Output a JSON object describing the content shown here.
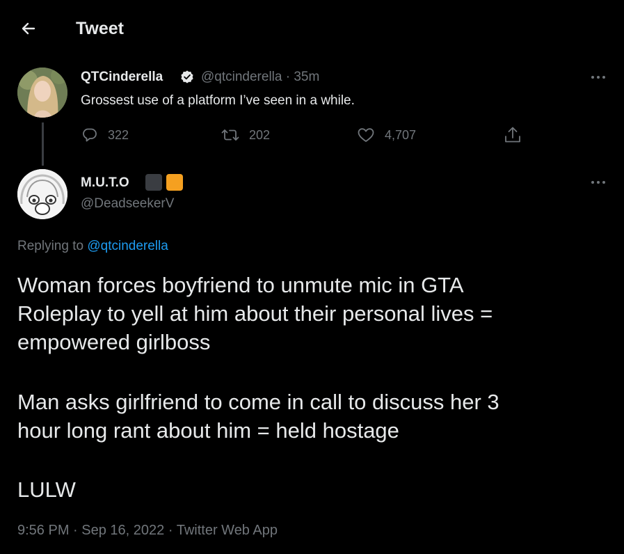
{
  "header": {
    "title": "Tweet"
  },
  "parent_tweet": {
    "name": "QTCinderella",
    "handle": "@qtcinderella",
    "separator": "·",
    "time": "35m",
    "text": "Grossest use of a platform I’ve seen in a while.",
    "replies": "322",
    "retweets": "202",
    "likes": "4,707"
  },
  "main_tweet": {
    "name": "M.U.T.O",
    "handle": "@DeadseekerV",
    "badge_colors": [
      "#3a3d42",
      "#f5a020"
    ],
    "replying_prefix": "Replying to",
    "replying_to": "@qtcinderella",
    "lines": [
      "Woman forces boyfriend to unmute mic in GTA",
      "Roleplay to yell at him about their personal lives =",
      "empowered girlboss",
      "Man asks girlfriend to come in call to discuss her 3",
      "hour long rant about him = held hostage",
      "LULW"
    ],
    "time": "9:56 PM",
    "date": "Sep 16, 2022",
    "source": "Twitter Web App",
    "meta_separator": "·"
  },
  "colors": {
    "background": "#000000",
    "text": "#e7e9ea",
    "secondary": "#71767b",
    "link": "#1d9bf0"
  }
}
